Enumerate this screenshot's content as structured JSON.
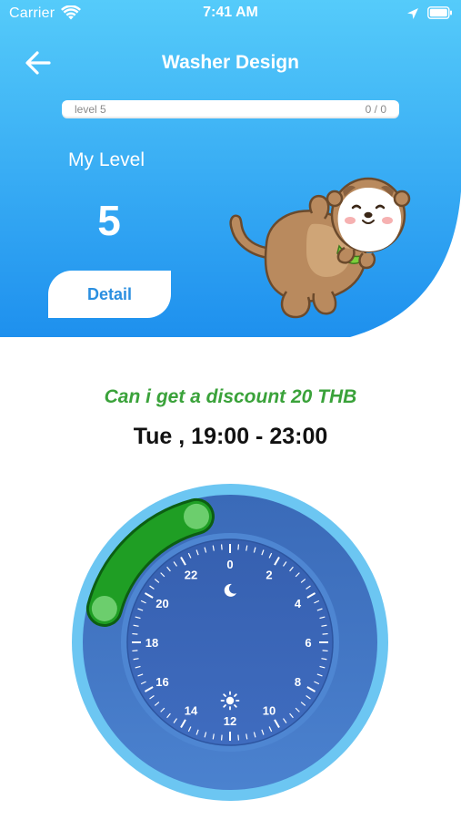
{
  "status_bar": {
    "carrier": "Carrier",
    "time": "7:41 AM",
    "icons": [
      "wifi-icon",
      "location-arrow-icon",
      "battery-icon"
    ]
  },
  "nav": {
    "title": "Washer Design",
    "back_icon": "arrow-left-icon"
  },
  "level_progress": {
    "label": "level 5",
    "count": "0 / 0",
    "fraction": 0
  },
  "level_card": {
    "my_level_label": "My Level",
    "level_value": "5",
    "detail_button": "Detail"
  },
  "mascot": "otter-mascot",
  "promotion": {
    "discount_text": "Can i get a discount 20 THB",
    "schedule_text": "Tue , 19:00 - 23:00"
  },
  "dial": {
    "hour_labels": [
      "0",
      "2",
      "4",
      "6",
      "8",
      "10",
      "12",
      "14",
      "16",
      "18",
      "20",
      "22"
    ],
    "icons": [
      "moon-icon",
      "sun-icon"
    ],
    "selected_start_hour": 19,
    "selected_end_hour": 23
  },
  "colors": {
    "header_top": "#48c3f8",
    "header_bottom": "#1f92ee",
    "selection_green": "#1e9a22",
    "dial_blue": "#3d6fc0",
    "dial_ring": "#62c0f0",
    "discount_green": "#3aa23a"
  }
}
